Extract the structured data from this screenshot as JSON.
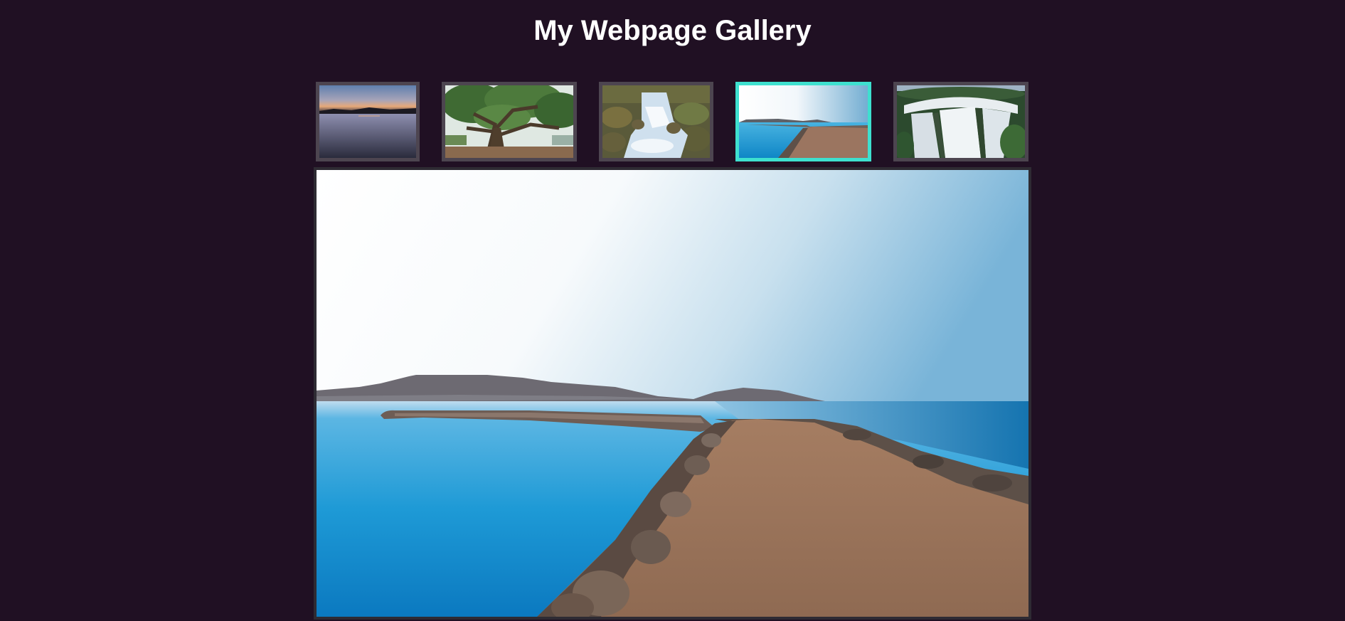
{
  "page": {
    "title": "My Webpage Gallery"
  },
  "gallery": {
    "active_index": 3,
    "active_color": "#3ee0cf",
    "thumbnails": [
      {
        "subject": "lake-sunset"
      },
      {
        "subject": "spreading-oak-tree"
      },
      {
        "subject": "mossy-waterfall-stream"
      },
      {
        "subject": "seaside-stone-jetty"
      },
      {
        "subject": "wide-cascading-waterfall"
      }
    ],
    "main_image": {
      "subject": "seaside-stone-jetty"
    }
  },
  "colors": {
    "background": "#201023",
    "title": "#ffffff",
    "thumb_border": "#4d4550"
  }
}
